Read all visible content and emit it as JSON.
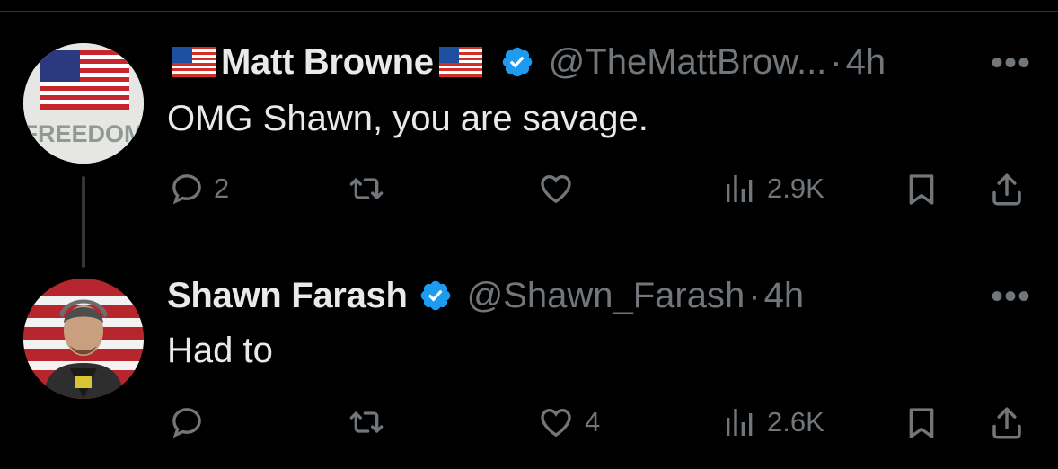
{
  "tweets": [
    {
      "display_name": "Matt Browne",
      "name_flag_left": "🇺🇸",
      "name_flag_right": "🇺🇸",
      "handle": "@TheMattBrow...",
      "separator": "·",
      "time": "4h",
      "text": "OMG Shawn, you are savage.",
      "avatar_text": "FREEDOM",
      "more_label": "•••",
      "reply_count": "2",
      "retweet_count": "",
      "like_count": "",
      "views_count": "2.9K"
    },
    {
      "display_name": "Shawn Farash",
      "handle": "@Shawn_Farash",
      "separator": "·",
      "time": "4h",
      "text": "Had to",
      "more_label": "•••",
      "reply_count": "",
      "retweet_count": "",
      "like_count": "4",
      "views_count": "2.6K"
    }
  ],
  "colors": {
    "background": "#000000",
    "primary_text": "#e7e9ea",
    "secondary_text": "#71767b",
    "verified_blue": "#1d9bf0",
    "thread_line": "#333639"
  },
  "icons": [
    "reply-icon",
    "retweet-icon",
    "like-icon",
    "views-icon",
    "bookmark-icon",
    "share-icon",
    "verified-badge-icon",
    "more-icon"
  ]
}
